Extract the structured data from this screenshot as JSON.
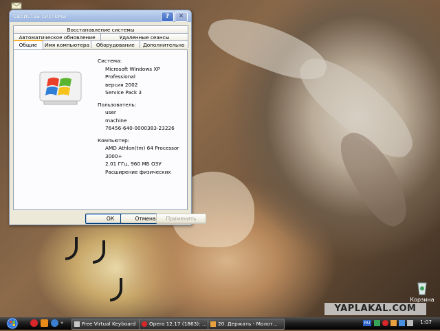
{
  "window": {
    "title": "Свойства системы",
    "tabs_row1": [
      "Восстановление системы"
    ],
    "tabs_row2": [
      "Автоматическое обновление",
      "Удаленные сеансы"
    ],
    "tabs_row3": [
      "Общие",
      "Имя компьютера",
      "Оборудование",
      "Дополнительно"
    ],
    "active_tab": "Общие",
    "system": {
      "heading": "Система:",
      "lines": [
        "Microsoft Windows XP",
        "Professional",
        "версия 2002",
        "Service Pack 3"
      ]
    },
    "user": {
      "heading": "Пользователь:",
      "lines": [
        "user",
        "machine",
        "76456-640-0000383-23226"
      ]
    },
    "computer": {
      "heading": "Компьютер:",
      "lines": [
        "AMD Athlon(tm) 64 Processor",
        "3000+",
        "2.01 ГГц, 960 МБ ОЗУ",
        "Расширение физических"
      ]
    },
    "buttons": {
      "ok": "ОК",
      "cancel": "Отмена",
      "apply": "Применить"
    }
  },
  "desktop": {
    "recycle_bin_label": "Корзина",
    "watermark": "YAPLAKAL.COM"
  },
  "taskbar": {
    "tasks": [
      "Free Virtual Keyboard",
      "Opera 12.17 (1863): ...",
      "20. Держать - Молот..."
    ],
    "language": "RU",
    "clock": "1:07"
  },
  "colors": {
    "titlebar": "#a9c1e6",
    "taskbar": "#1c1c1c",
    "tab_highlight": "#f8b133"
  }
}
